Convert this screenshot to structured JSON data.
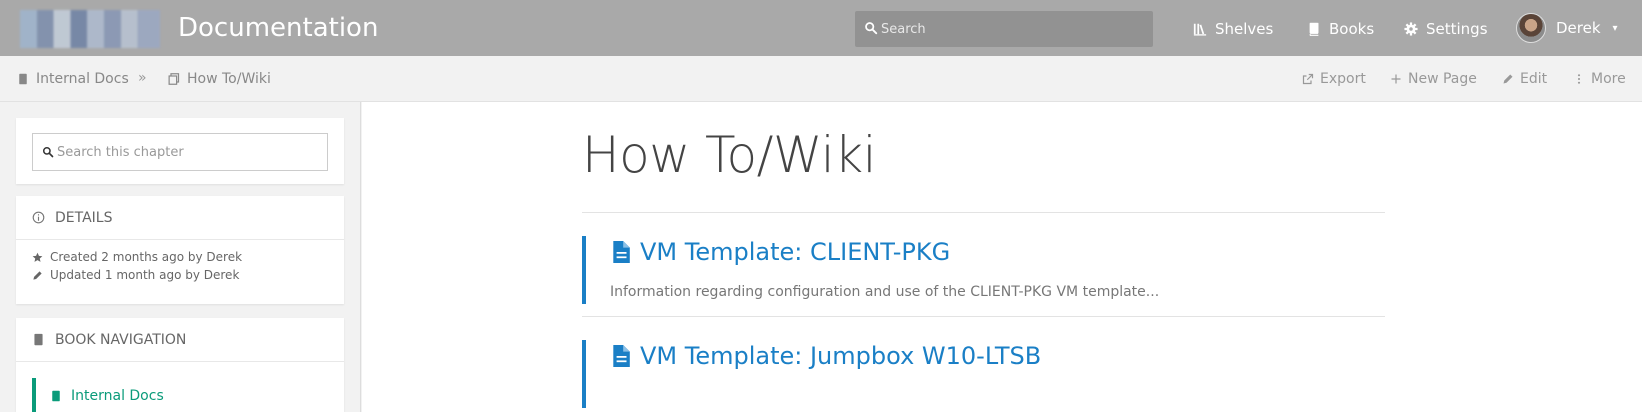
{
  "header": {
    "app_title": "Documentation",
    "search_placeholder": "Search",
    "nav": [
      {
        "label": "Shelves",
        "icon": "shelves-icon"
      },
      {
        "label": "Books",
        "icon": "book-icon"
      },
      {
        "label": "Settings",
        "icon": "gear-icon"
      }
    ],
    "user_name": "Derek"
  },
  "breadcrumb": {
    "items": [
      {
        "label": "Internal Docs",
        "icon": "book-icon"
      },
      {
        "label": "How To/Wiki",
        "icon": "chapter-icon"
      }
    ],
    "separator": "»"
  },
  "actions": [
    {
      "label": "Export",
      "icon": "export-icon"
    },
    {
      "label": "New Page",
      "icon": "plus-icon"
    },
    {
      "label": "Edit",
      "icon": "pencil-icon"
    },
    {
      "label": "More",
      "icon": "more-icon"
    }
  ],
  "sidebar": {
    "chapter_search_placeholder": "Search this chapter",
    "details": {
      "heading": "Details",
      "created": "Created 2 months ago by Derek",
      "updated": "Updated 1 month ago by Derek"
    },
    "book_navigation": {
      "heading": "Book Navigation",
      "items": [
        {
          "label": "Internal Docs",
          "active": true
        }
      ]
    }
  },
  "main": {
    "title": "How To/Wiki",
    "pages": [
      {
        "title": "VM Template: CLIENT-PKG",
        "excerpt": "Information regarding configuration and use of the CLIENT-PKG VM template..."
      },
      {
        "title": "VM Template: Jumpbox W10-LTSB",
        "excerpt": ""
      }
    ]
  },
  "colors": {
    "header_bg": "#a9a9a9",
    "link_blue": "#1a7fc6",
    "nav_green": "#0a9b7a"
  }
}
